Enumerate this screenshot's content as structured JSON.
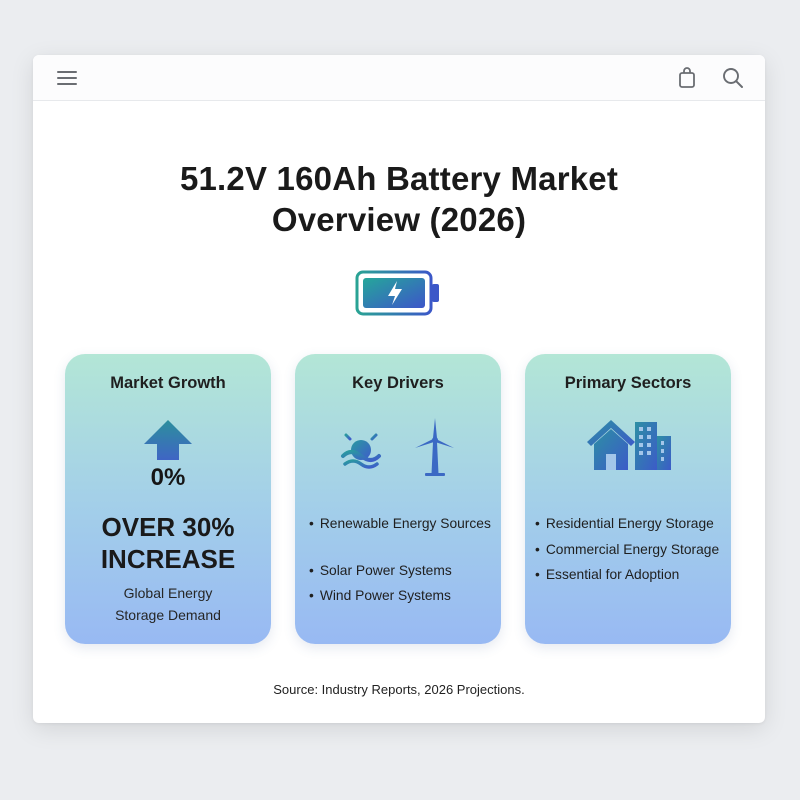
{
  "toolbar": {
    "menu_icon": "hamburger-menu-icon",
    "bag_icon": "shopping-bag-icon",
    "search_icon": "search-icon"
  },
  "header": {
    "title_line1": "51.2V 160Ah Battery Market",
    "title_line2": "Overview (2026)",
    "battery_icon": "battery-charging-icon",
    "accent_gradient": [
      "#1f9a93",
      "#3e5ed1"
    ]
  },
  "cards": [
    {
      "title": "Market Growth",
      "icon": "up-arrow-icon",
      "percent": "0%",
      "headline_line1": "OVER 30%",
      "headline_line2": "INCREASE",
      "sub_line1": "Global Energy",
      "sub_line2": "Storage Demand"
    },
    {
      "title": "Key Drivers",
      "icons": [
        "sun-icon",
        "wind-turbine-icon"
      ],
      "bullets": [
        "Renewable Energy Sources",
        "Solar Power Systems",
        "Wind Power Systems"
      ]
    },
    {
      "title": "Primary Sectors",
      "icon": "house-building-icon",
      "bullets": [
        "Residential Energy Storage",
        "Commercial Energy Storage",
        "Essential for Adoption"
      ]
    }
  ],
  "footer": {
    "source": "Source: Industry Reports, 2026 Projections."
  },
  "colors": {
    "card_gradient_top": "#b3e6d6",
    "card_gradient_bottom": "#98b9f3",
    "icon_teal": "#2b8e9c",
    "icon_blue": "#3f63c8"
  }
}
